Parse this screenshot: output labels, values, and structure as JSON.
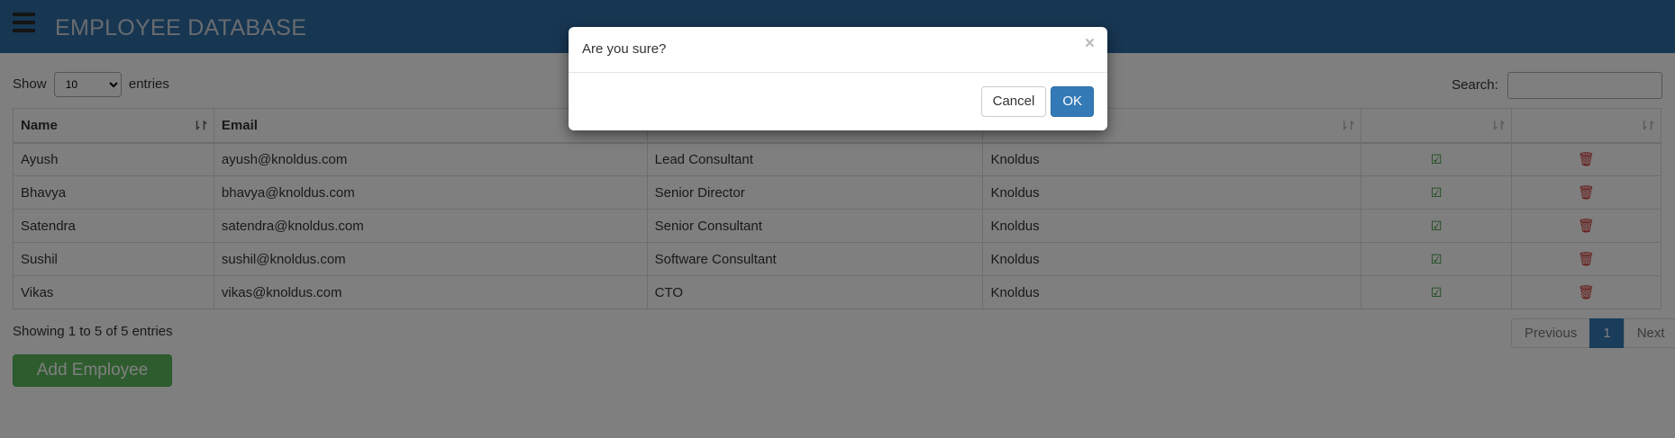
{
  "header": {
    "title": "EMPLOYEE DATABASE",
    "menu_icon": "hamburger-icon"
  },
  "controls": {
    "show_label": "Show",
    "entries_label": "entries",
    "page_size": "10",
    "search_label": "Search:",
    "search_value": ""
  },
  "table": {
    "columns": [
      "Name",
      "Email",
      "",
      "",
      "",
      ""
    ],
    "rows": [
      {
        "name": "Ayush",
        "email": "ayush@knoldus.com",
        "designation": "Lead Consultant",
        "company": "Knoldus"
      },
      {
        "name": "Bhavya",
        "email": "bhavya@knoldus.com",
        "designation": "Senior Director",
        "company": "Knoldus"
      },
      {
        "name": "Satendra",
        "email": "satendra@knoldus.com",
        "designation": "Senior Consultant",
        "company": "Knoldus"
      },
      {
        "name": "Sushil",
        "email": "sushil@knoldus.com",
        "designation": "Software Consultant",
        "company": "Knoldus"
      },
      {
        "name": "Vikas",
        "email": "vikas@knoldus.com",
        "designation": "CTO",
        "company": "Knoldus"
      }
    ],
    "row_icons": {
      "edit": "edit-icon",
      "delete": "trash-icon"
    }
  },
  "footer": {
    "info": "Showing 1 to 5 of 5 entries",
    "pagination": {
      "previous": "Previous",
      "current": "1",
      "next": "Next"
    },
    "add_button": "Add Employee"
  },
  "modal": {
    "title": "Are you sure?",
    "close": "×",
    "cancel": "Cancel",
    "ok": "OK"
  },
  "colors": {
    "navbar": "#2e6da4",
    "primary": "#337ab7",
    "success": "#5cb85c",
    "danger": "#c9302c",
    "edit": "#1e8a1e"
  }
}
